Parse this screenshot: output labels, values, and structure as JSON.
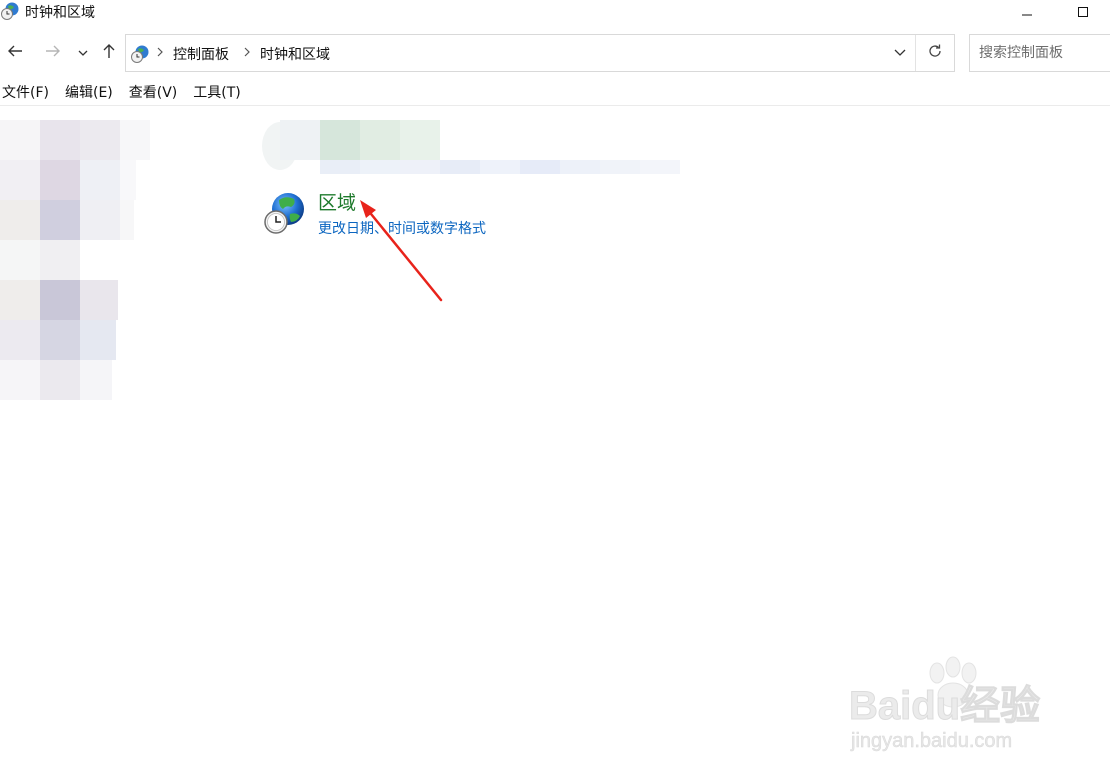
{
  "window": {
    "title": "时钟和区域"
  },
  "breadcrumb": {
    "items": [
      "控制面板",
      "时钟和区域"
    ]
  },
  "search": {
    "placeholder": "搜索控制面板",
    "value": ""
  },
  "menu": {
    "items": [
      "文件(F)",
      "编辑(E)",
      "查看(V)",
      "工具(T)"
    ]
  },
  "content": {
    "region_title": "区域",
    "region_link": "更改日期、时间或数字格式"
  },
  "watermark": {
    "brand": "Baidu经验",
    "url": "jingyan.baidu.com"
  },
  "icons": {
    "window": "clock-globe-icon",
    "back": "arrow-left-icon",
    "forward": "arrow-right-icon",
    "recent": "chevron-down-icon",
    "up": "arrow-up-icon",
    "refresh": "refresh-icon",
    "region": "globe-clock-icon",
    "annotation": "red-arrow-icon"
  },
  "colors": {
    "region_title": "#1e7a2c",
    "link": "#0c66c0",
    "annotation_arrow": "#e8231b"
  }
}
